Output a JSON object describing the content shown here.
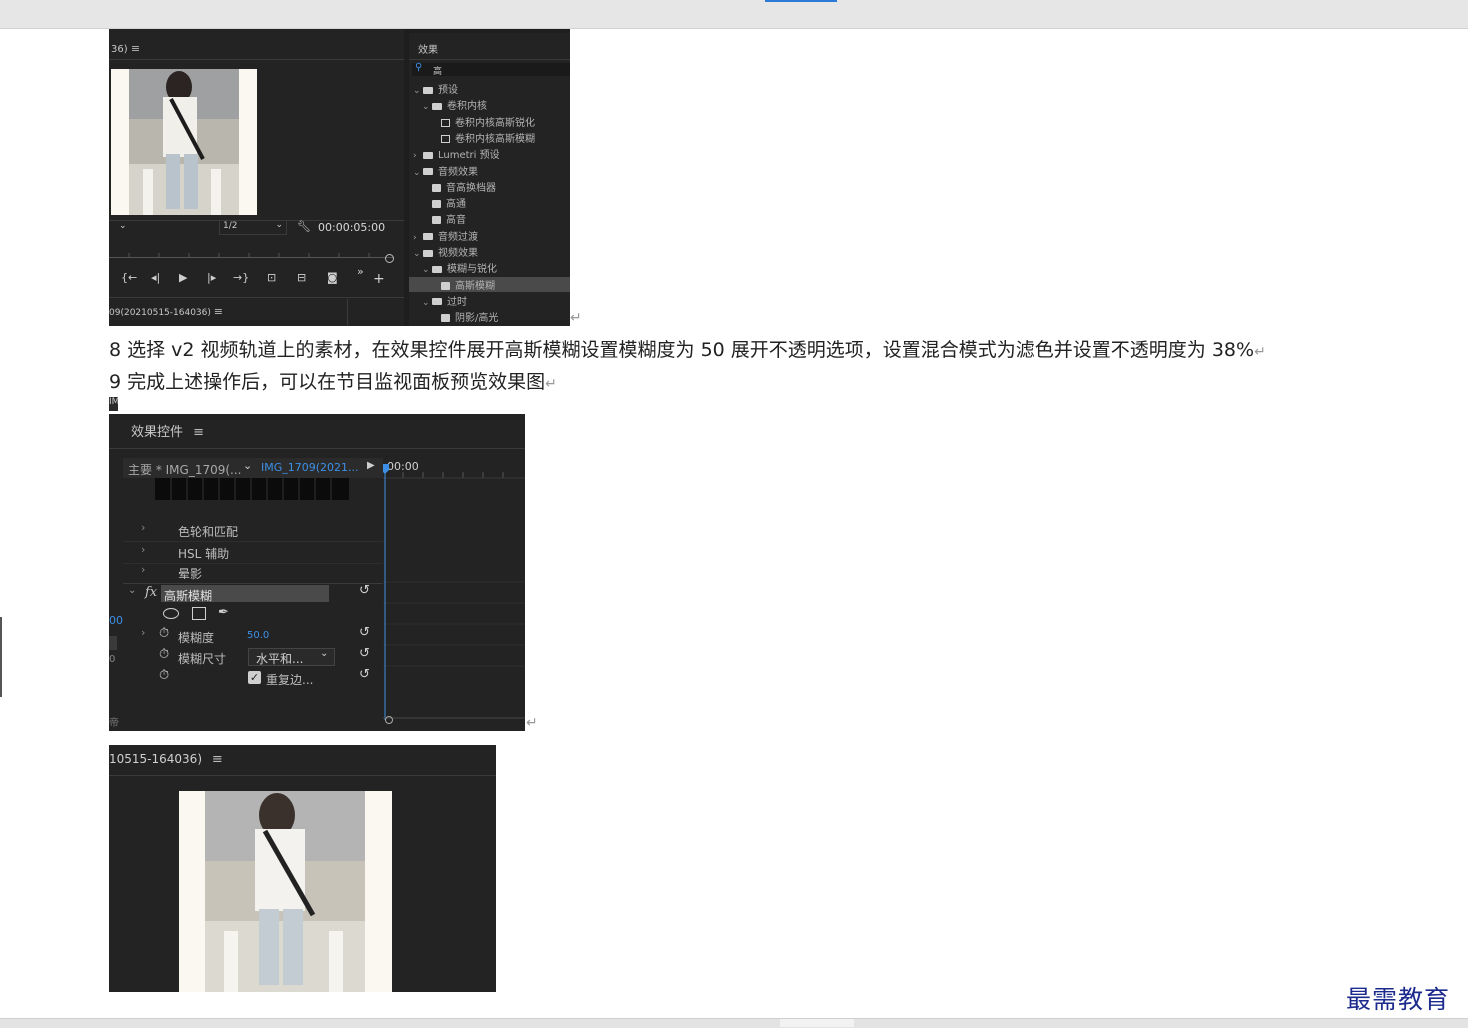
{
  "watermark": "最需教育",
  "paragraphs": {
    "step8": "8 选择 v2 视频轨道上的素材，在效果控件展开高斯模糊设置模糊度为 50 展开不透明选项，设置混合模式为滤色并设置不透明度为 38%",
    "step9": "9 完成上述操作后，可以在节目监视面板预览效果图",
    "return_mark": "↵"
  },
  "screenshot1": {
    "monitor": {
      "title_fragment": "36)",
      "menu_icon": "≡",
      "zoom_value": "1/2",
      "timecode": "00:00:05:00",
      "bottom_tab_fragment": "09(20210515-164036)",
      "controls": [
        "mark-in-icon",
        "step-back-icon",
        "play-icon",
        "step-forward-icon",
        "mark-out-icon",
        "lift-icon",
        "extract-icon",
        "camera-icon",
        "more-icon",
        "add-icon"
      ]
    },
    "effects": {
      "title": "效果",
      "search_value": "高",
      "tree": [
        {
          "label": "预设",
          "level": 0,
          "type": "folder-preset",
          "expanded": true
        },
        {
          "label": "卷积内核",
          "level": 1,
          "type": "folder-preset",
          "expanded": true
        },
        {
          "label": "卷积内核高斯锐化",
          "level": 2,
          "type": "preset"
        },
        {
          "label": "卷积内核高斯模糊",
          "level": 2,
          "type": "preset"
        },
        {
          "label": "Lumetri 预设",
          "level": 0,
          "type": "folder-preset",
          "expanded": false
        },
        {
          "label": "音频效果",
          "level": 0,
          "type": "folder",
          "expanded": true
        },
        {
          "label": "音高换档器",
          "level": 1,
          "type": "effect"
        },
        {
          "label": "高通",
          "level": 1,
          "type": "effect"
        },
        {
          "label": "高音",
          "level": 1,
          "type": "effect"
        },
        {
          "label": "音频过渡",
          "level": 0,
          "type": "folder",
          "expanded": false
        },
        {
          "label": "视频效果",
          "level": 0,
          "type": "folder",
          "expanded": true
        },
        {
          "label": "模糊与锐化",
          "level": 1,
          "type": "folder",
          "expanded": true
        },
        {
          "label": "高斯模糊",
          "level": 2,
          "type": "effect",
          "selected": true
        },
        {
          "label": "过时",
          "level": 1,
          "type": "folder",
          "expanded": true
        },
        {
          "label": "阴影/高光",
          "level": 2,
          "type": "effect"
        }
      ]
    }
  },
  "screenshot2": {
    "corner_fragment": "IM",
    "panel_title": "效果控件",
    "menu_icon": "≡",
    "master_clip": "主要 * IMG_1709(...",
    "sequence_clip": "IMG_1709(2021...",
    "timeline_time": "00:00",
    "sections": [
      "色轮和匹配",
      "HSL 辅助",
      "晕影"
    ],
    "effect": {
      "fx_label": "fx",
      "name": "高斯模糊",
      "properties": {
        "blurriness_label": "模糊度",
        "blurriness_value": "50.0",
        "dimension_label": "模糊尺寸",
        "dimension_value": "水平和...",
        "repeat_edge_label": "重复边..."
      }
    },
    "left_fragments": [
      "00",
      "0",
      "帝"
    ]
  },
  "screenshot3": {
    "title_fragment": "10515-164036)",
    "menu_icon": "≡"
  },
  "colors": {
    "panel_bg": "#232323",
    "accent_blue": "#3d8fe6",
    "watermark": "#1b2a8c"
  }
}
